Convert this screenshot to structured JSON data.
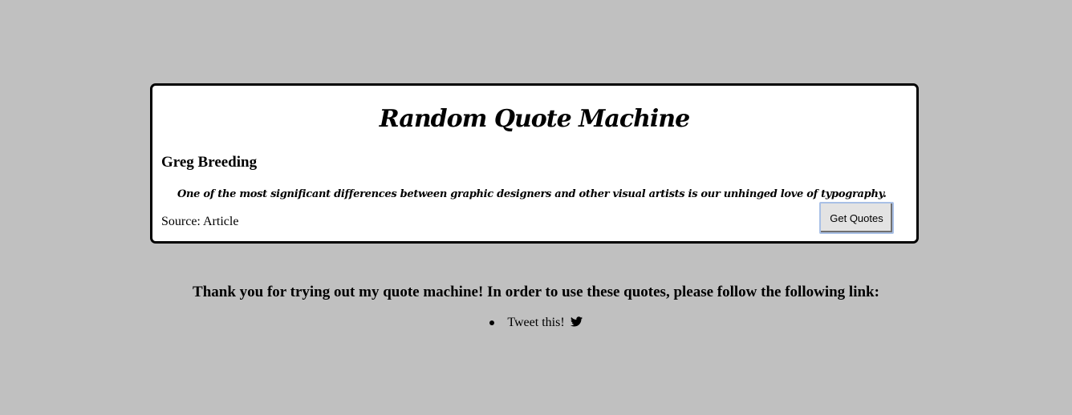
{
  "card": {
    "title": "Random Quote Machine",
    "author": "Greg Breeding",
    "quote": "One of the most significant differences between graphic designers and other visual artists is our unhinged love of typography.",
    "source": "Source: Article",
    "button_label": "Get Quotes"
  },
  "footer": {
    "message": "Thank you for trying out my quote machine! In order to use these quotes, please follow the following link:",
    "links": [
      {
        "label": "Tweet this!",
        "icon": "twitter-icon"
      }
    ]
  },
  "colors": {
    "background": "#c0c0c0",
    "card": "#ffffff",
    "border": "#000000",
    "button": "#e3e3e3"
  }
}
